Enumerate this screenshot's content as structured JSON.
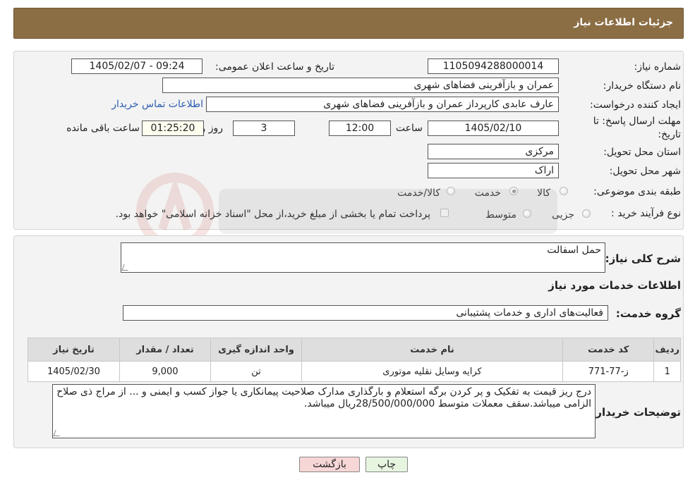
{
  "header": {
    "title": "جزئیات اطلاعات نیاز"
  },
  "fields": {
    "need_number_label": "شماره نیاز:",
    "need_number": "1105094288000014",
    "announce_label": "تاریخ و ساعت اعلان عمومی:",
    "announce_value": "1405/02/07 - 09:24",
    "buyer_org_label": "نام دستگاه خریدار:",
    "buyer_org": "عمران و بازآفرینی فضاهای شهری",
    "creator_label": "ایجاد کننده درخواست:",
    "creator": "عارف عابدی کارپرداز عمران و بازآفرینی فضاهای شهری",
    "contact_link": "اطلاعات تماس خریدار",
    "deadline_label_1": "مهلت ارسال پاسخ: تا",
    "deadline_label_2": "تاریخ:",
    "deadline_date": "1405/02/10",
    "time_label": "ساعت",
    "deadline_time": "12:00",
    "days_value": "3",
    "days_label": "روز و",
    "remaining_value": "01:25:20",
    "remaining_label": "ساعت باقی مانده",
    "province_label": "استان محل تحویل:",
    "province": "مرکزی",
    "city_label": "شهر محل تحویل:",
    "city": "اراک",
    "category_label": "طبقه بندی موضوعی:",
    "category_options": [
      "کالا",
      "خدمت",
      "کالا/خدمت"
    ],
    "category_selected": "خدمت",
    "process_label": "نوع فرآیند خرید :",
    "process_options": [
      "جزیی",
      "متوسط"
    ],
    "process_note": "پرداخت تمام یا بخشی از مبلغ خرید،از محل \"اسناد خزانه اسلامی\" خواهد بود."
  },
  "summary": {
    "label": "شرح کلی نیاز:",
    "value": "حمل اسفالت"
  },
  "services": {
    "section_title": "اطلاعات خدمات مورد نیاز",
    "group_label": "گروه خدمت:",
    "group_value": "فعالیت‌های اداری و خدمات پشتیبانی",
    "columns": [
      "ردیف",
      "کد خدمت",
      "نام خدمت",
      "واحد اندازه گیری",
      "تعداد / مقدار",
      "تاریخ نیاز"
    ],
    "rows": [
      [
        "1",
        "ز-77-771",
        "کرایه وسایل نقلیه موتوری",
        "تن",
        "9,000",
        "1405/02/30"
      ]
    ]
  },
  "buyer_notes": {
    "label": "توضیحات خریدار:",
    "text": "درج ریز قیمت به تفکیک و  پر کردن  برگه استعلام و بارگذاری مدارک صلاحیت پیمانکاری یا جواز کسب و ایمنی و ...  از مراج ذی صلاح الزامی میباشد.سقف معملات متوسط 28/500/000/000ریال میباشد."
  },
  "buttons": {
    "print": "چاپ",
    "back": "بازگشت"
  },
  "colors": {
    "header_bg": "#8c6e45",
    "back_button_bg": "#f7d6d6",
    "print_button_bg": "#e6f5e0"
  }
}
